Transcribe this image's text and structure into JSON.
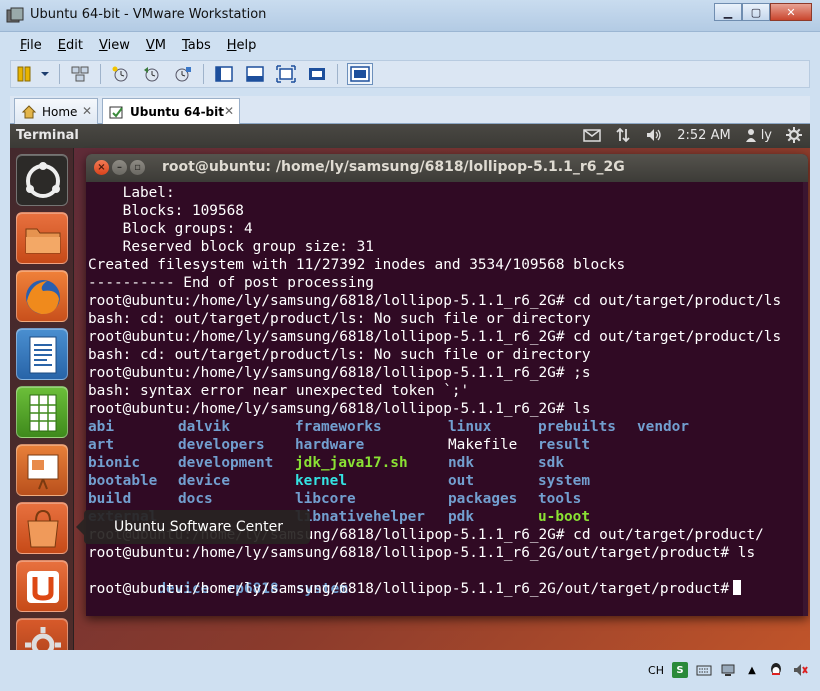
{
  "window": {
    "title": "Ubuntu 64-bit - VMware Workstation"
  },
  "menu": {
    "items": [
      "File",
      "Edit",
      "View",
      "VM",
      "Tabs",
      "Help"
    ]
  },
  "tabs": [
    {
      "label": "Home"
    },
    {
      "label": "Ubuntu 64-bit"
    }
  ],
  "ubuntu_topbar": {
    "app_title": "Terminal",
    "clock": "2:52 AM",
    "user": "ly"
  },
  "tooltip": {
    "text": "Ubuntu Software Center"
  },
  "terminal": {
    "title": "root@ubuntu: /home/ly/samsung/6818/lollipop-5.1.1_r6_2G",
    "lines_before": [
      "    Label:",
      "    Blocks: 109568",
      "    Block groups: 4",
      "    Reserved block group size: 31",
      "Created filesystem with 11/27392 inodes and 3534/109568 blocks",
      "---------- End of post processing",
      "root@ubuntu:/home/ly/samsung/6818/lollipop-5.1.1_r6_2G# cd out/target/product/ls",
      "bash: cd: out/target/product/ls: No such file or directory",
      "root@ubuntu:/home/ly/samsung/6818/lollipop-5.1.1_r6_2G# cd out/target/product/ls",
      "bash: cd: out/target/product/ls: No such file or directory",
      "root@ubuntu:/home/ly/samsung/6818/lollipop-5.1.1_r6_2G# ;s",
      "bash: syntax error near unexpected token `;'",
      "root@ubuntu:/home/ly/samsung/6818/lollipop-5.1.1_r6_2G# ls"
    ],
    "ls_rows": [
      [
        [
          "abi",
          "dir"
        ],
        [
          "dalvik",
          "dir"
        ],
        [
          "frameworks",
          "dir"
        ],
        [
          "linux",
          "dir"
        ],
        [
          "prebuilts",
          "dir"
        ],
        [
          "vendor",
          "dir"
        ]
      ],
      [
        [
          "art",
          "dir"
        ],
        [
          "developers",
          "dir"
        ],
        [
          "hardware",
          "dir"
        ],
        [
          "Makefile",
          "file"
        ],
        [
          "result",
          "dir"
        ],
        [
          "",
          ""
        ]
      ],
      [
        [
          "bionic",
          "dir"
        ],
        [
          "development",
          "dir"
        ],
        [
          "jdk_java17.sh",
          "exec"
        ],
        [
          "ndk",
          "dir"
        ],
        [
          "sdk",
          "dir"
        ],
        [
          "",
          ""
        ]
      ],
      [
        [
          "bootable",
          "dir"
        ],
        [
          "device",
          "dir"
        ],
        [
          "kernel",
          "cyan"
        ],
        [
          "out",
          "dir"
        ],
        [
          "system",
          "dir"
        ],
        [
          "",
          ""
        ]
      ],
      [
        [
          "build",
          "dir"
        ],
        [
          "docs",
          "dir"
        ],
        [
          "libcore",
          "dir"
        ],
        [
          "packages",
          "dir"
        ],
        [
          "tools",
          "dir"
        ],
        [
          "",
          ""
        ]
      ],
      [
        [
          "external",
          "dir"
        ],
        [
          "",
          "dir"
        ],
        [
          "libnativehelper",
          "dir"
        ],
        [
          "pdk",
          "dir"
        ],
        [
          "u-boot",
          "exec"
        ],
        [
          "",
          ""
        ]
      ]
    ],
    "lines_after": [
      "root@ubuntu:/home/ly/samsung/6818/lollipop-5.1.1_r6_2G# cd out/target/product/",
      "root@ubuntu:/home/ly/samsung/6818/lollipop-5.1.1_r6_2G/out/target/product# ls"
    ],
    "product_ls": [
      "device",
      "rp6818",
      "system"
    ],
    "prompt_last": "root@ubuntu:/home/ly/samsung/6818/lollipop-5.1.1_r6_2G/out/target/product#"
  },
  "tray": {
    "ime": "CH"
  },
  "colors": {
    "terminal_bg": "#300a24",
    "dir": "#729fcf",
    "exec": "#8ae234",
    "accent_orange": "#dd4814"
  }
}
